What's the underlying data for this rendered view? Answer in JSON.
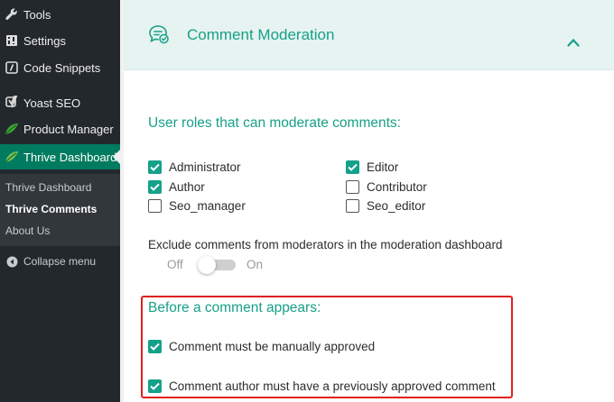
{
  "sidebar": {
    "items": [
      {
        "label": "Tools",
        "icon": "wrench-icon"
      },
      {
        "label": "Settings",
        "icon": "settings-icon"
      },
      {
        "label": "Code Snippets",
        "icon": "code-icon"
      },
      {
        "label": "Yoast SEO",
        "icon": "yoast-icon"
      },
      {
        "label": "Product Manager",
        "icon": "leaf-icon"
      },
      {
        "label": "Thrive Dashboard",
        "icon": "leaf-icon",
        "active": true
      }
    ],
    "submenu": [
      {
        "label": "Thrive Dashboard"
      },
      {
        "label": "Thrive Comments",
        "current": true
      },
      {
        "label": "About Us"
      }
    ],
    "collapse_label": "Collapse menu"
  },
  "panel": {
    "title": "Comment Moderation",
    "title_icon": "comment-check-icon",
    "collapse_icon": "chevron-up-icon"
  },
  "moderators": {
    "title": "User roles that can moderate comments:",
    "roles": [
      {
        "label": "Administrator",
        "checked": true
      },
      {
        "label": "Editor",
        "checked": true
      },
      {
        "label": "Author",
        "checked": true
      },
      {
        "label": "Contributor",
        "checked": false
      },
      {
        "label": "Seo_manager",
        "checked": false
      },
      {
        "label": "Seo_editor",
        "checked": false
      }
    ]
  },
  "exclude": {
    "label": "Exclude comments from moderators in the moderation dashboard",
    "off_label": "Off",
    "on_label": "On",
    "enabled": false
  },
  "before_appears": {
    "title": "Before a comment appears:",
    "options": [
      {
        "label": "Comment must be manually approved",
        "checked": true
      },
      {
        "label": "Comment author must have a previously approved comment",
        "checked": true
      }
    ]
  },
  "colors": {
    "accent": "#18a088",
    "sidebar_bg": "#23282d",
    "active_menu": "#007b5f",
    "highlight": "#e02020"
  }
}
